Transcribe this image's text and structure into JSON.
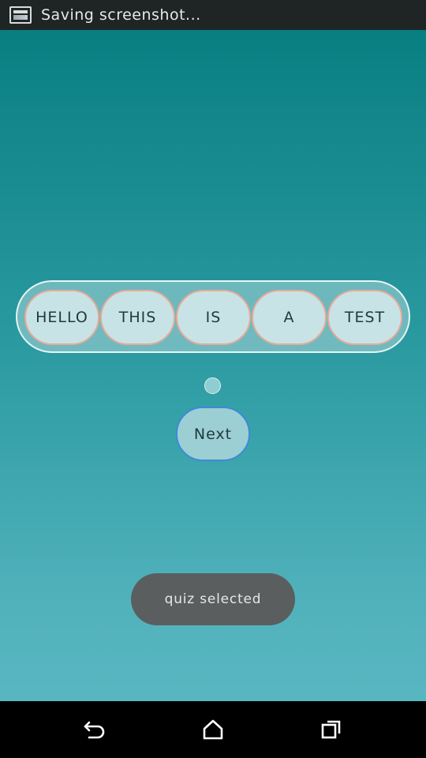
{
  "status_bar": {
    "notification_icon": "screenshot-icon",
    "text": "Saving screenshot..."
  },
  "quiz": {
    "words": [
      "HELLO",
      "THIS",
      "IS",
      "A",
      "TEST"
    ]
  },
  "next_button": {
    "label": "Next"
  },
  "toast": {
    "text": "quiz selected"
  },
  "nav_bar": {
    "icons": [
      "back-icon",
      "home-icon",
      "recents-icon"
    ]
  },
  "colors": {
    "background_top": "#067c7f",
    "background_bottom": "#5bb9c4",
    "chip_fill": "#c8e3e5",
    "chip_border": "#e8a999",
    "next_border": "#3d8ad8",
    "toast_bg": "#5b5e5f"
  }
}
